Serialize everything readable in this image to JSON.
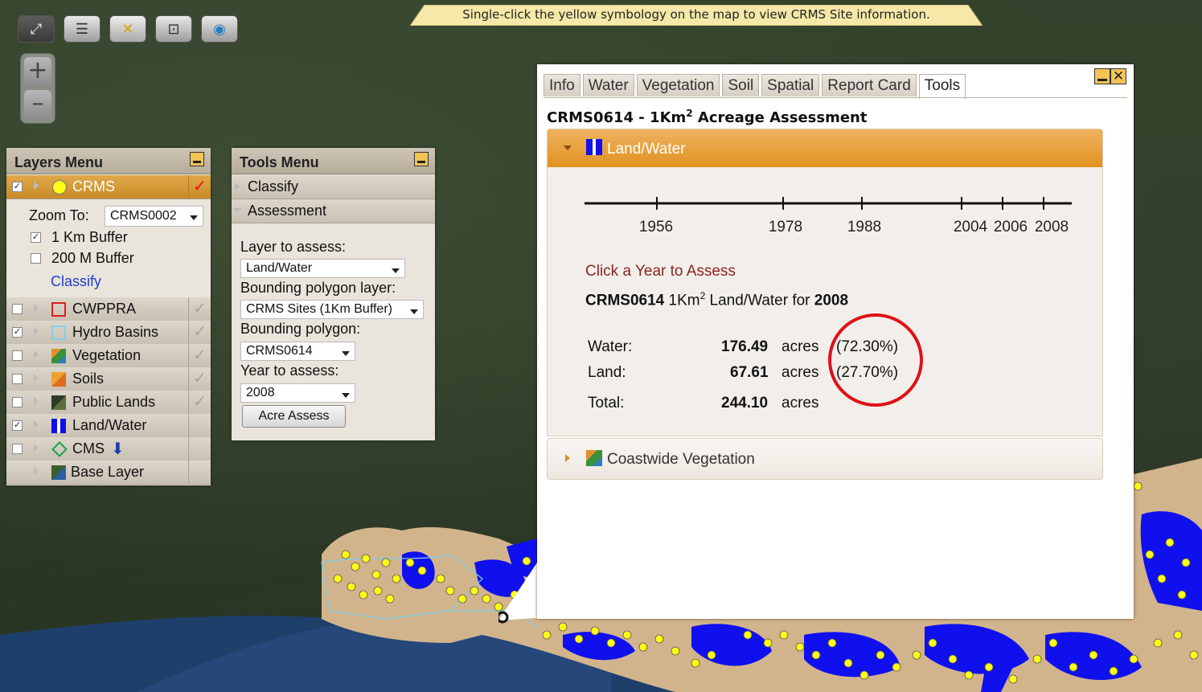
{
  "banner": {
    "text": "Single-click the yellow symbology on the map to view CRMS Site information."
  },
  "toolbar": {
    "buttons": [
      {
        "icon": "fullscreen-icon"
      },
      {
        "icon": "layers-icon"
      },
      {
        "icon": "clear-icon"
      },
      {
        "icon": "zoom-extent-icon"
      },
      {
        "icon": "globe-icon"
      }
    ]
  },
  "zoom": {
    "in_label": "+",
    "out_label": "–"
  },
  "layers_menu": {
    "title": "Layers Menu",
    "crms": {
      "label": "CRMS",
      "checked": true
    },
    "zoom_to_label": "Zoom To:",
    "zoom_to_value": "CRMS0002",
    "buffer_1km": "1 Km Buffer",
    "buffer_200m": "200 M Buffer",
    "classify_link": "Classify",
    "layers": [
      {
        "label": "CWPPRA",
        "checked": false
      },
      {
        "label": "Hydro Basins",
        "checked": true
      },
      {
        "label": "Vegetation",
        "checked": false
      },
      {
        "label": "Soils",
        "checked": false
      },
      {
        "label": "Public Lands",
        "checked": false
      },
      {
        "label": "Land/Water",
        "checked": true
      },
      {
        "label": "CMS",
        "checked": false
      },
      {
        "label": "Base Layer"
      }
    ]
  },
  "tools_menu": {
    "title": "Tools Menu",
    "sections": [
      "Classify",
      "Assessment"
    ],
    "layer_to_assess_label": "Layer to assess:",
    "layer_to_assess_value": "Land/Water",
    "bounding_layer_label": "Bounding polygon layer:",
    "bounding_layer_value": "CRMS Sites (1Km Buffer)",
    "bounding_polygon_label": "Bounding polygon:",
    "bounding_polygon_value": "CRMS0614",
    "year_label": "Year to assess:",
    "year_value": "2008",
    "acre_assess_button": "Acre Assess"
  },
  "info_window": {
    "tabs": [
      "Info",
      "Water",
      "Vegetation",
      "Soil",
      "Spatial",
      "Report Card",
      "Tools"
    ],
    "active_tab": "Tools",
    "title_prefix": "CRMS0614 - 1Km",
    "title_sup": "2",
    "title_suffix": " Acreage Assessment",
    "section_land_water": "Land/Water",
    "years": [
      "1956",
      "1978",
      "1988",
      "2004",
      "2006",
      "2008"
    ],
    "hint": "Click a Year to Assess",
    "result_site": "CRMS0614",
    "result_unit": " 1Km",
    "result_sup": "2",
    "result_mid": " Land/Water for ",
    "result_year": "2008",
    "water_label": "Water:",
    "water_value": "176.49",
    "water_unit": "acres",
    "water_pct": "(72.30%)",
    "land_label": "Land:",
    "land_value": "67.61",
    "land_unit": "acres",
    "land_pct": "(27.70%)",
    "total_label": "Total:",
    "total_value": "244.10",
    "total_unit": "acres",
    "section_vegetation": "Coastwide Vegetation"
  },
  "colors": {
    "accent_orange": "#e1901f",
    "highlight_red": "#e0101a",
    "water_blue": "#1010ee",
    "site_yellow": "#ffff14"
  }
}
